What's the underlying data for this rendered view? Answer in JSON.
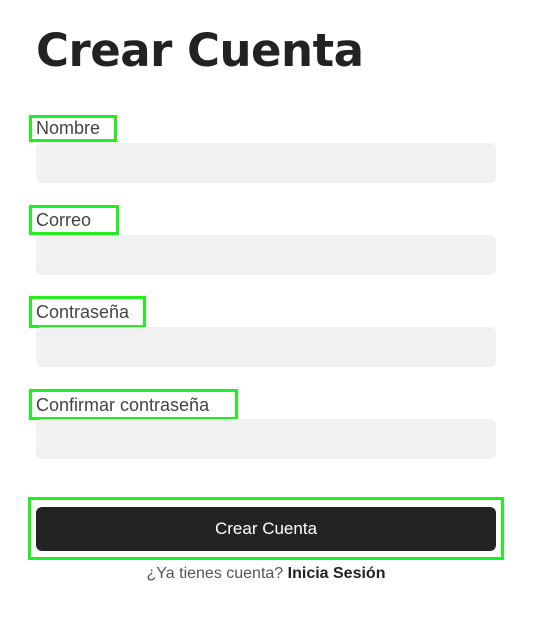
{
  "page": {
    "title": "Crear Cuenta"
  },
  "form": {
    "fields": [
      {
        "label": "Nombre",
        "value": ""
      },
      {
        "label": "Correo",
        "value": ""
      },
      {
        "label": "Contraseña",
        "value": ""
      },
      {
        "label": "Confirmar contraseña",
        "value": ""
      }
    ],
    "submit_label": "Crear Cuenta"
  },
  "footer": {
    "prompt_text": "¿Ya tienes cuenta?",
    "link_text": "Inicia Sesión"
  },
  "colors": {
    "highlight": "#22ee22",
    "button_bg": "#232323",
    "input_bg": "#f1f1f1",
    "text_dark": "#222222"
  }
}
